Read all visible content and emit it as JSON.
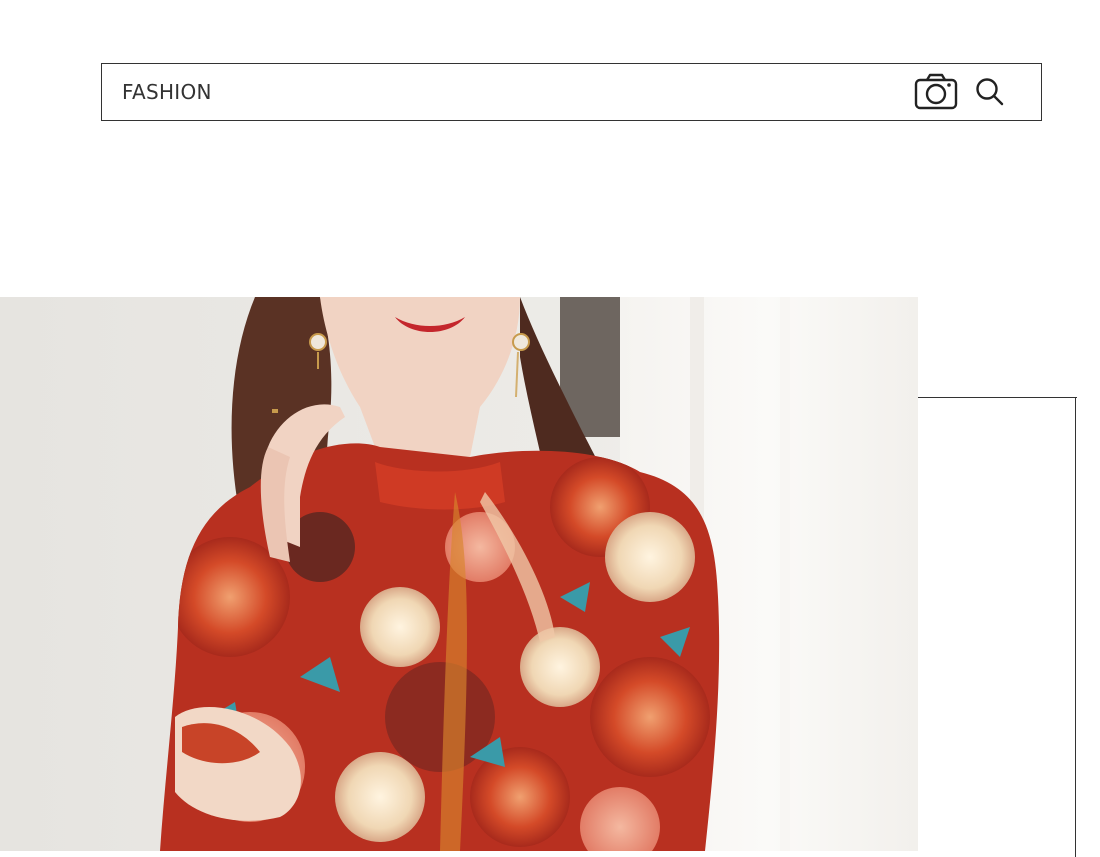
{
  "search": {
    "value": "FASHION",
    "camera_icon": "camera-icon",
    "search_icon": "search-icon"
  },
  "hero": {
    "image_subject": "model-in-floral-blouse",
    "colors": {
      "wall": "#e9e7e3",
      "curtain": "#f4f2ef",
      "floral_red": "#c8371f",
      "floral_cream": "#f2e2c8",
      "hair": "#5a3224",
      "skin": "#f1d3c3"
    }
  }
}
